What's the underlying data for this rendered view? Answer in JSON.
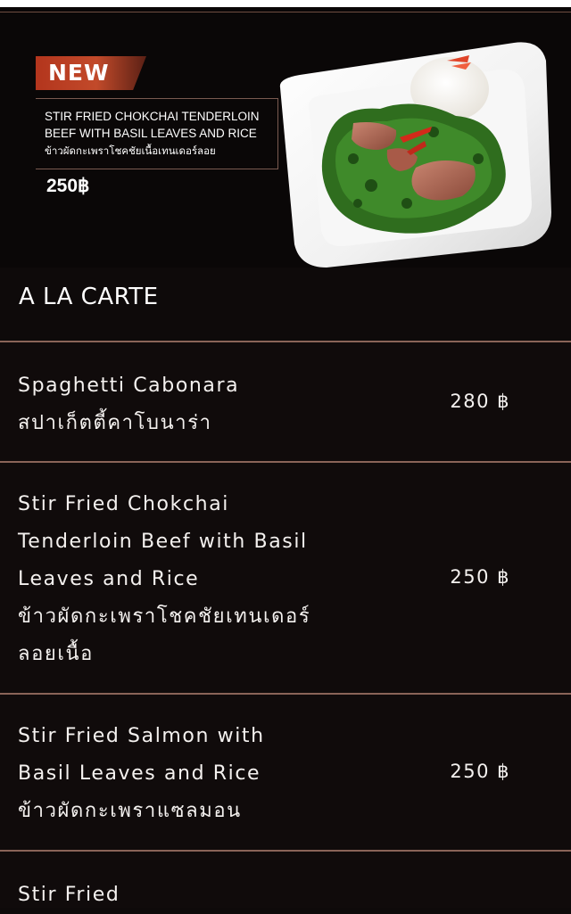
{
  "featured": {
    "badge": "NEW",
    "name_line1": "STIR FRIED CHOKCHAI TENDERLOIN",
    "name_line2": "BEEF WITH BASIL LEAVES AND RICE",
    "name_th": "ข้าวผัดกะเพราโชคชัยเนื้อเทนเดอร์ลอย",
    "price": "250฿",
    "image": "basil-beef-plate-photo"
  },
  "section": {
    "title": "A LA CARTE"
  },
  "items": [
    {
      "lines": [
        "Spaghetti Cabonara",
        "สปาเก็ตตี้คาโบนาร่า"
      ],
      "price": "280 ฿"
    },
    {
      "lines": [
        "Stir Fried Chokchai",
        "Tenderloin Beef with Basil",
        "Leaves and Rice",
        "ข้าวผัดกะเพราโชคชัยเทนเดอร์",
        "ลอยเนื้อ"
      ],
      "price": "250 ฿"
    },
    {
      "lines": [
        "Stir Fried Salmon with",
        "Basil Leaves and Rice",
        "ข้าวผัดกะเพราแซลมอน"
      ],
      "price": "250 ฿"
    },
    {
      "lines": [
        "Stir Fried"
      ],
      "price": ""
    }
  ],
  "colors": {
    "background": "#100b0b",
    "divider": "#8a6458",
    "badge": "#c24a2a",
    "text": "#f4f1ef"
  }
}
